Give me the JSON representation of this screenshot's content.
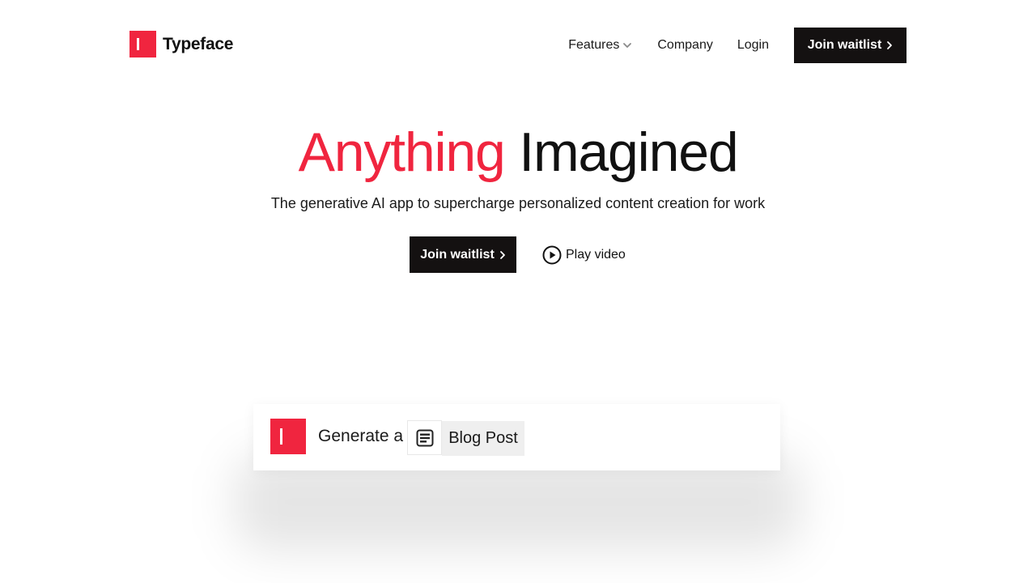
{
  "brand": {
    "name": "Typeface",
    "color": "#f0253f"
  },
  "nav": {
    "features": "Features",
    "company": "Company",
    "login": "Login",
    "cta": "Join waitlist"
  },
  "hero": {
    "title_accent": "Anything",
    "title_rest": "Imagined",
    "subtitle": "The generative AI app to supercharge personalized content creation for work",
    "cta": "Join waitlist",
    "play_video": "Play video"
  },
  "demo": {
    "prompt_text": "Generate a",
    "content_type": "Blog Post",
    "content_type_icon": "document-icon"
  },
  "colors": {
    "accent": "#f0253f",
    "dark_button": "#141111",
    "text": "#111111"
  }
}
